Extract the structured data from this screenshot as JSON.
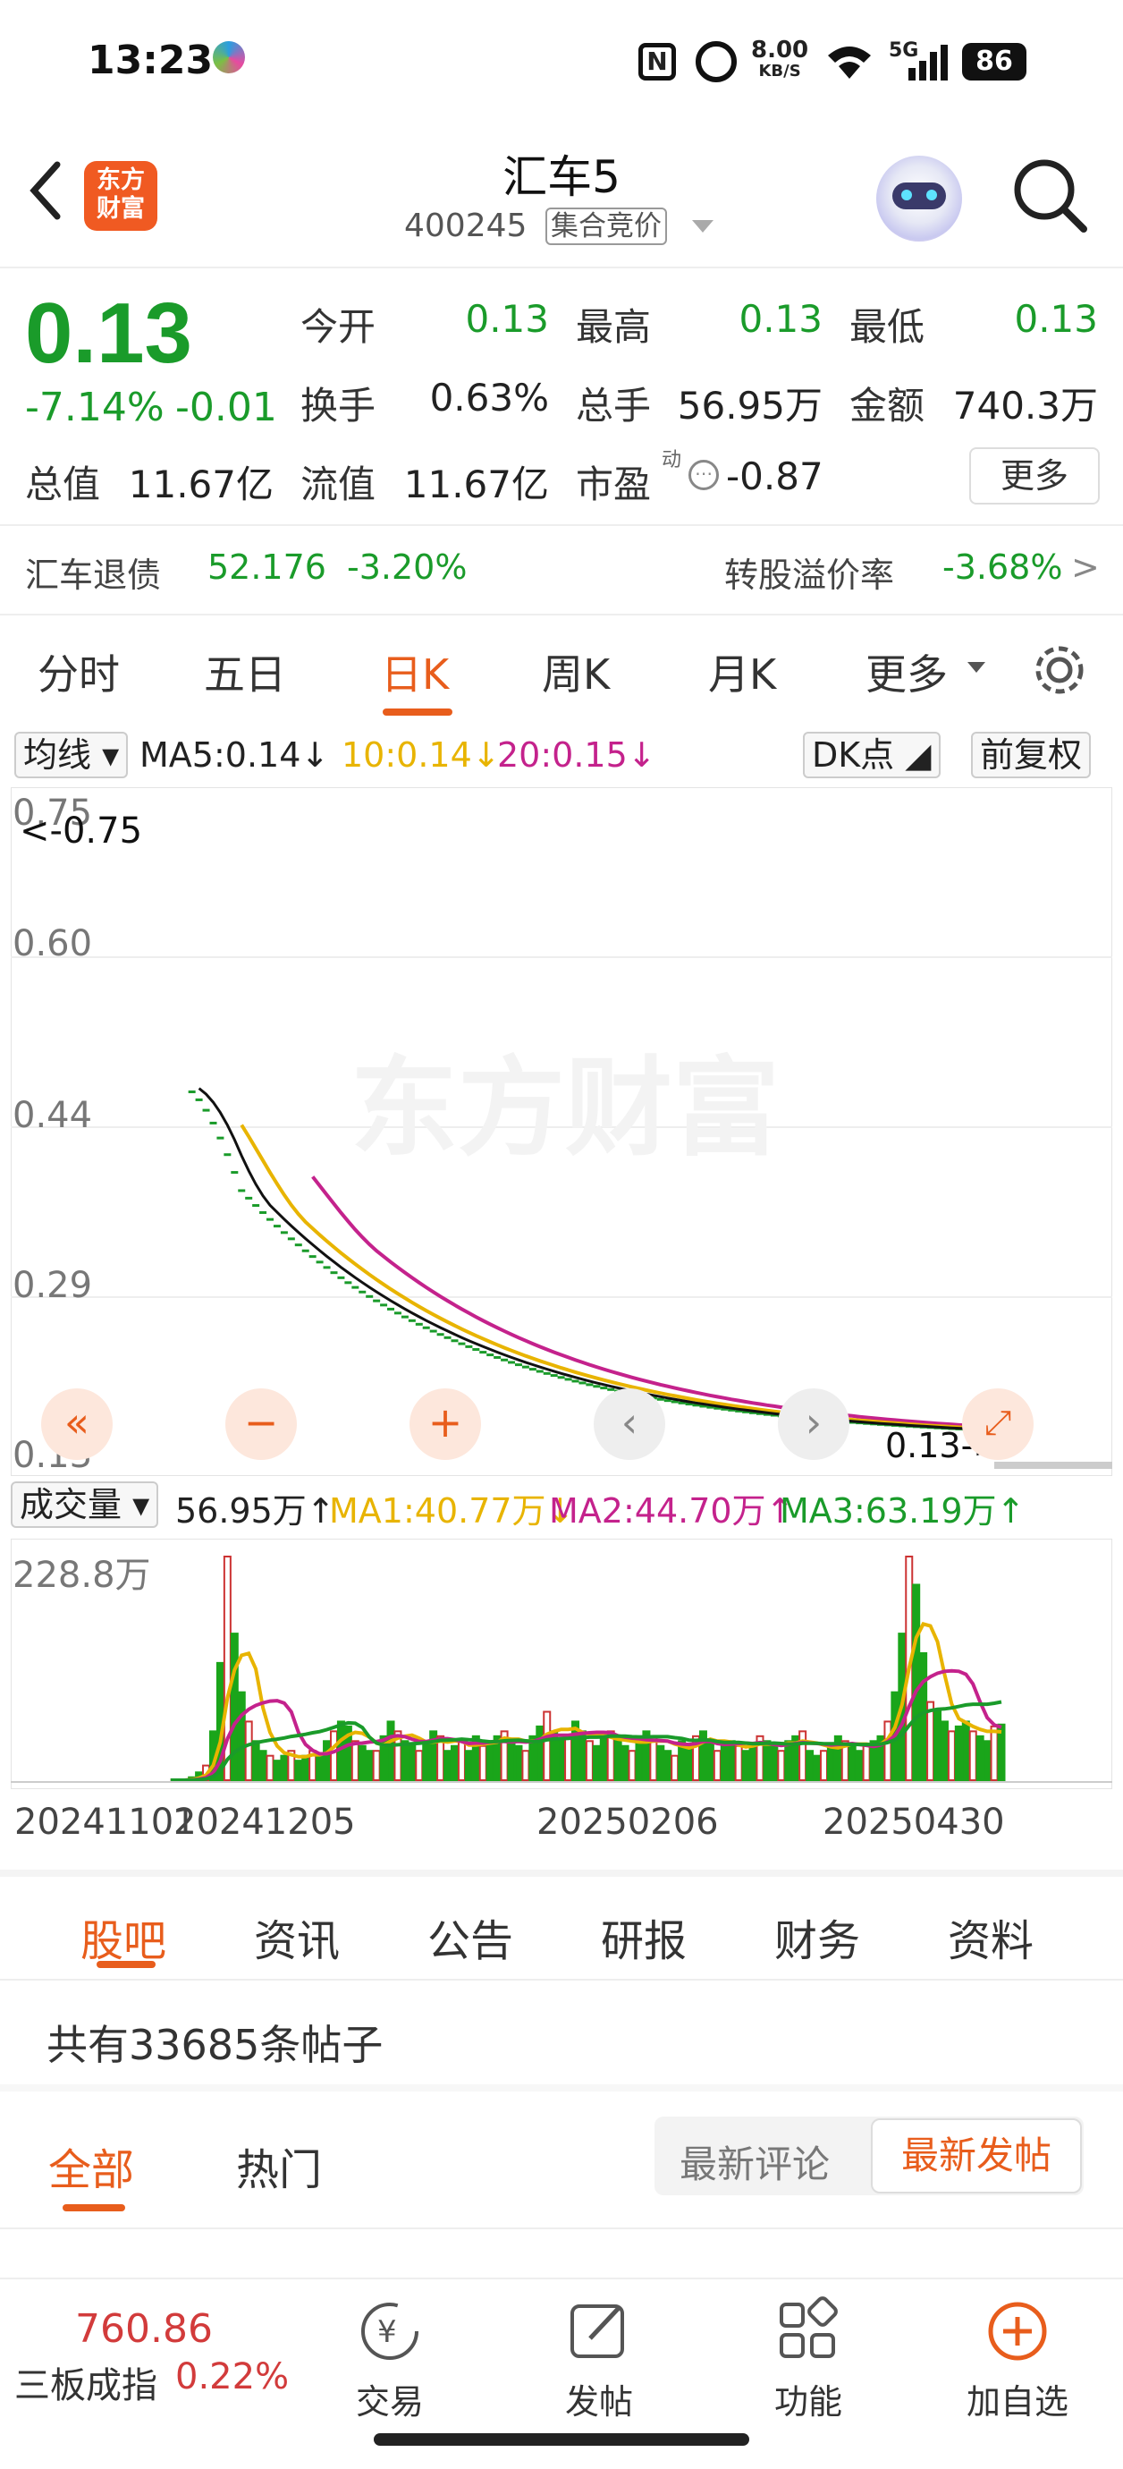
{
  "status": {
    "time": "13:23",
    "net_speed": "8.00",
    "net_unit": "KB/S",
    "network": "5G",
    "battery": "86"
  },
  "header": {
    "name": "汇车5",
    "code": "400245",
    "tag": "集合竞价",
    "logo_line1": "东方",
    "logo_line2": "财富"
  },
  "quote": {
    "price": "0.13",
    "change_pct": "-7.14%",
    "change": "-0.01",
    "open_label": "今开",
    "open": "0.13",
    "high_label": "最高",
    "high": "0.13",
    "low_label": "最低",
    "low": "0.13",
    "turnover_label": "换手",
    "turnover": "0.63%",
    "volume_label": "总手",
    "volume": "56.95万",
    "amount_label": "金额",
    "amount": "740.3万",
    "mktcap_label": "总值",
    "mktcap": "11.67亿",
    "float_label": "流值",
    "float": "11.67亿",
    "pe_label": "市盈",
    "pe_sup": "动",
    "pe": "-0.87",
    "more": "更多"
  },
  "bond": {
    "name": "汇车退债",
    "price": "52.176",
    "pct": "-3.20%",
    "premium_label": "转股溢价率",
    "premium": "-3.68%",
    "arrow": ">"
  },
  "chart_tabs": [
    "分时",
    "五日",
    "日K",
    "周K",
    "月K",
    "更多"
  ],
  "chart_tab_active": 2,
  "ma_legend": {
    "type": "均线",
    "ma5": "MA5:0.14↓",
    "ma10": "10:0.14↓",
    "ma20": "20:0.15↓",
    "dk": "DK点",
    "adj": "前复权"
  },
  "kline_axis": [
    "0.75",
    "0.60",
    "0.44",
    "0.29",
    "0.13"
  ],
  "kline_marks": {
    "high": "<-0.75",
    "low": "0.13->"
  },
  "vol_legend": {
    "type": "成交量",
    "vol": "56.95万↑",
    "ma1": "MA1:40.77万↓",
    "ma2": "MA2:44.70万↑",
    "ma3": "MA3:63.19万↑"
  },
  "vol_axis_max": "228.8万",
  "dates": [
    "20241101",
    "20241205",
    "20250206",
    "20250430"
  ],
  "chart_data": {
    "type": "bar",
    "title": "",
    "ylim_price": [
      0.13,
      0.75
    ],
    "ylim_volume": [
      0,
      228.8
    ],
    "ma5_last": 0.14,
    "ma10_last": 0.14,
    "ma20_last": 0.15,
    "volume_unit": "万",
    "volume_values": [
      0,
      0,
      0,
      0,
      0,
      0,
      0,
      0,
      0,
      0,
      0,
      0,
      0,
      0,
      0,
      0,
      0,
      0,
      0,
      0,
      0,
      0,
      0,
      3,
      8,
      15,
      50,
      120,
      228.8,
      150,
      90,
      60,
      40,
      30,
      25,
      20,
      25,
      30,
      20,
      25,
      30,
      25,
      40,
      50,
      60,
      55,
      40,
      35,
      30,
      30,
      45,
      60,
      50,
      40,
      35,
      30,
      40,
      50,
      45,
      30,
      35,
      40,
      30,
      45,
      35,
      40,
      45,
      50,
      40,
      35,
      30,
      45,
      55,
      70,
      50,
      40,
      45,
      60,
      50,
      40,
      35,
      45,
      50,
      40,
      35,
      30,
      40,
      50,
      45,
      35,
      30,
      25,
      40,
      35,
      45,
      50,
      40,
      30,
      35,
      40,
      35,
      30,
      35,
      45,
      40,
      35,
      30,
      40,
      45,
      50,
      30,
      25,
      30,
      35,
      45,
      40,
      35,
      30,
      35,
      40,
      45,
      60,
      90,
      150,
      228.8,
      200,
      130,
      80,
      70,
      60,
      50,
      55,
      60,
      50,
      45,
      40,
      55,
      56.95
    ]
  },
  "subtabs": [
    "股吧",
    "资讯",
    "公告",
    "研报",
    "财务",
    "资料"
  ],
  "post_count": "共有33685条帖子",
  "filter": {
    "all": "全部",
    "hot": "热门",
    "latest_comment": "最新评论",
    "latest_post": "最新发帖"
  },
  "bottom": {
    "index_value": "760.86",
    "index_name": "三板成指",
    "index_pct": "0.22%",
    "trade": "交易",
    "post": "发帖",
    "func": "功能",
    "add": "加自选"
  }
}
